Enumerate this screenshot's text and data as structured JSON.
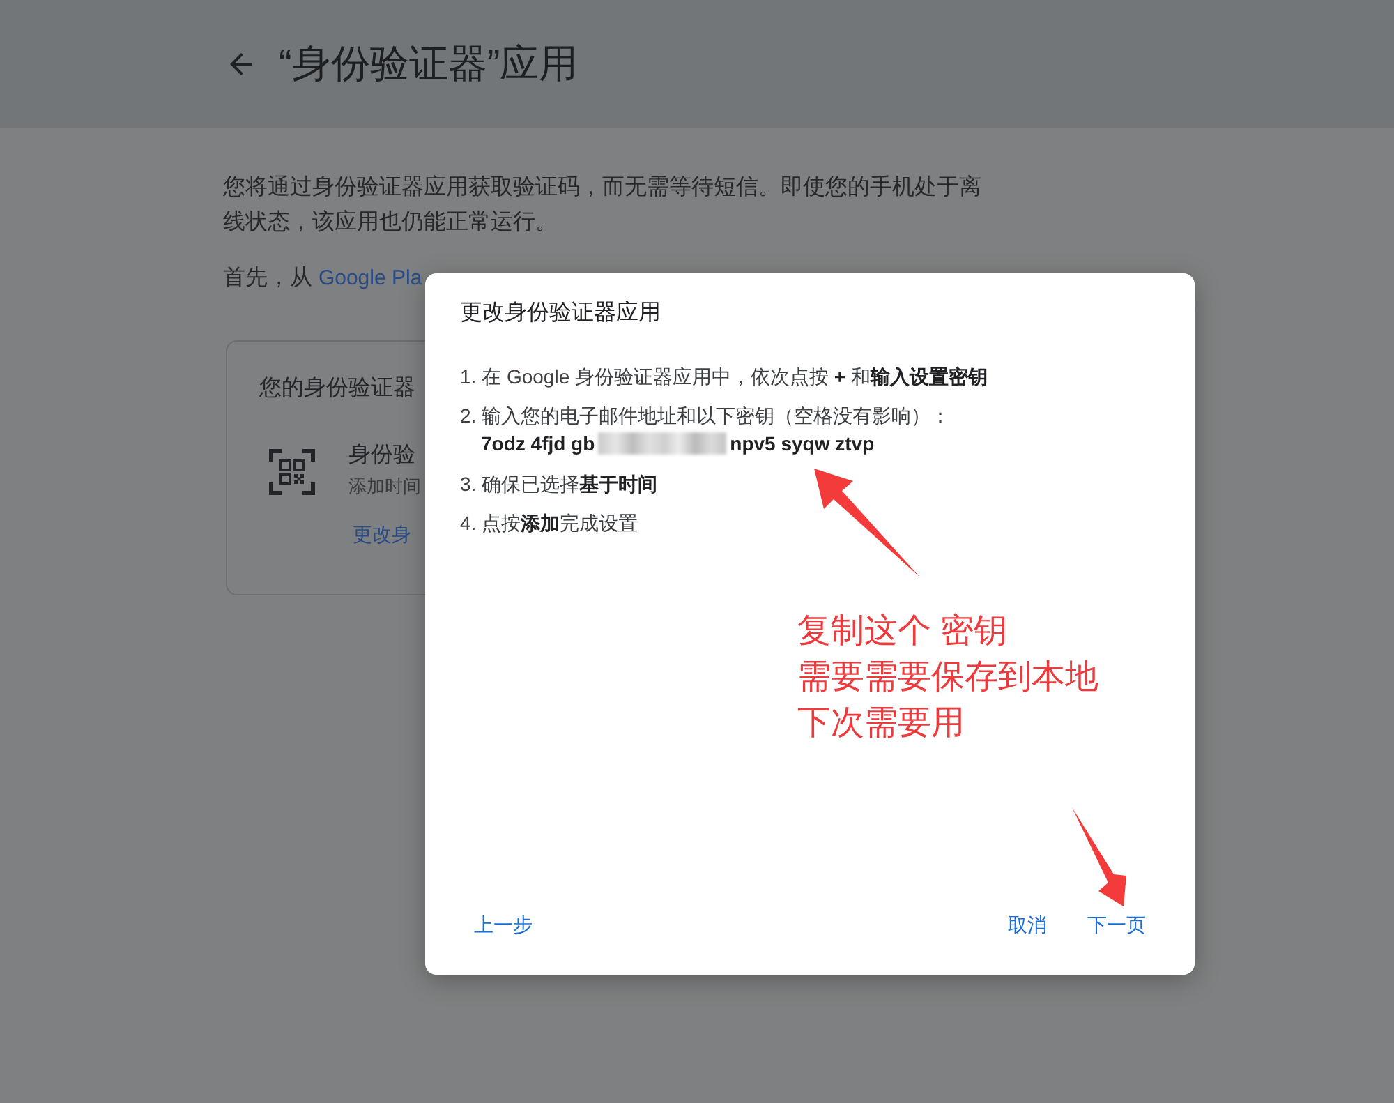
{
  "page": {
    "title": "“身份验证器”应用",
    "intro": "您将通过身份验证器应用获取验证码，而无需等待短信。即使您的手机处于离线状态，该应用也仍能正常运行。",
    "download": {
      "text": "首先，从 ",
      "link": "Google Pla"
    }
  },
  "card": {
    "heading": "您的身份验证器",
    "item": {
      "name": "身份验",
      "subtitle": "添加时间",
      "link": "更改身"
    }
  },
  "dialog": {
    "title": "更改身份验证器应用",
    "steps": [
      {
        "text": "1. 在 Google 身份验证器应用中，依次点按 **+** 和**输入设置密钥**"
      },
      {
        "text": "2. 输入您的电子邮件地址和以下密钥（空格没有影响）：",
        "secret_key": {
          "before_blur": "7odz 4fjd gb",
          "after_blur": "npv5 syqw ztvp"
        }
      },
      {
        "text": "3. 确保已选择**基于时间**"
      },
      {
        "text": "4. 点按**添加**完成设置"
      }
    ],
    "buttons": {
      "back": "上一步",
      "cancel": "取消",
      "next": "下一页"
    }
  },
  "annotation": {
    "lines": [
      "复制这个 密钥",
      "需要需要保存到本地",
      "下次需要用"
    ]
  }
}
